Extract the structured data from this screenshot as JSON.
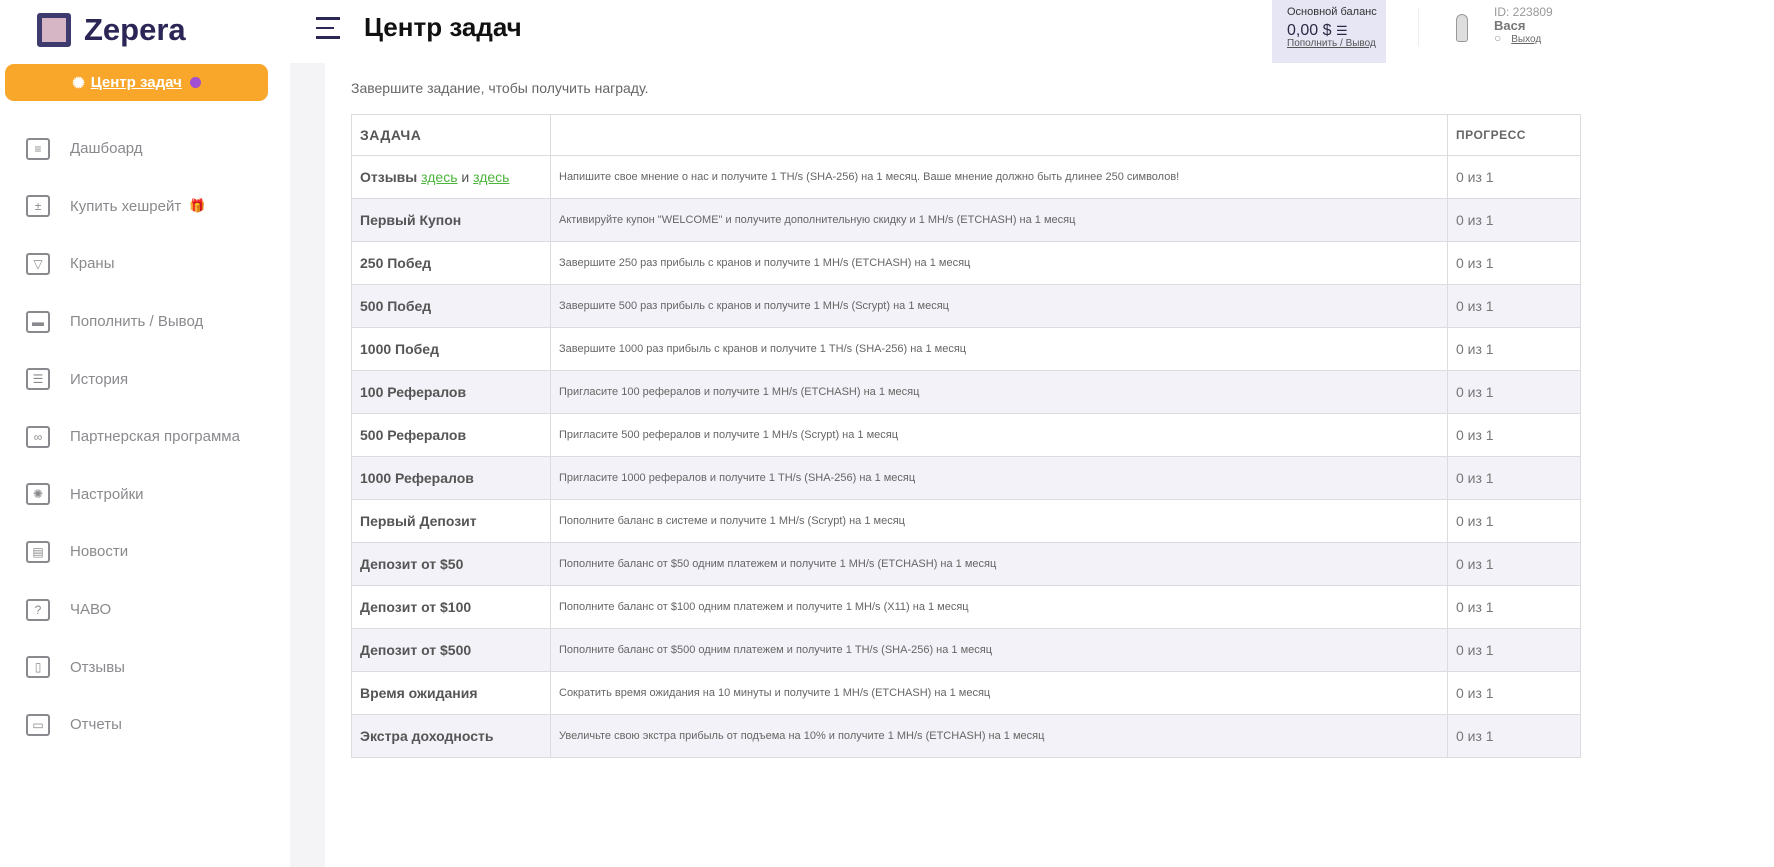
{
  "brand": "Zepera",
  "sidebar": {
    "task_center": "Центр задач",
    "items": [
      {
        "label": "Дашбоард",
        "icon": "dashboard-icon"
      },
      {
        "label": "Купить хешрейт",
        "icon": "calculator-icon"
      },
      {
        "label": "Краны",
        "icon": "funnel-icon"
      },
      {
        "label": "Пополнить / Вывод",
        "icon": "card-icon"
      },
      {
        "label": "История",
        "icon": "list-icon"
      },
      {
        "label": "Партнерская программа",
        "icon": "link-icon"
      },
      {
        "label": "Настройки",
        "icon": "gear-icon"
      },
      {
        "label": "Новости",
        "icon": "news-icon"
      },
      {
        "label": "ЧАВО",
        "icon": "question-icon"
      },
      {
        "label": "Отзывы",
        "icon": "reviews-icon"
      },
      {
        "label": "Отчеты",
        "icon": "monitor-icon"
      }
    ]
  },
  "header": {
    "title": "Центр задач",
    "balance_label": "Основной баланс",
    "balance": "0,00 $",
    "deposit_link": "Пополнить / Вывод",
    "user_id": "ID: 223809",
    "user_name": "Вася",
    "logout": "Выход"
  },
  "content": {
    "hint": "Завершите задание, чтобы получить награду.",
    "col_task": "ЗАДАЧА",
    "col_progress": "ПРОГРЕСС",
    "first_row": {
      "title": "Отзывы",
      "link1": "здесь",
      "and": "и",
      "link2": "здесь",
      "desc": "Напишите свое мнение о нас и получите 1 TH/s (SHA-256) на 1 месяц. Ваше мнение должно быть длинее 250 символов!",
      "progress": "0 из 1"
    },
    "rows": [
      {
        "title": "Первый Купон",
        "desc": "Активируйте купон \"WELCOME\" и получите дополнительную скидку и 1 MH/s (ETCHASH) на 1 месяц",
        "progress": "0 из 1"
      },
      {
        "title": "250 Побед",
        "desc": "Завершите 250 раз прибыль с кранов и получите 1 MH/s (ETCHASH) на 1 месяц",
        "progress": "0 из 1"
      },
      {
        "title": "500 Побед",
        "desc": "Завершите 500 раз прибыль с кранов и получите 1 MH/s (Scrypt) на 1 месяц",
        "progress": "0 из 1"
      },
      {
        "title": "1000 Побед",
        "desc": "Завершите 1000 раз прибыль с кранов и получите 1 TH/s (SHA-256) на 1 месяц",
        "progress": "0 из 1"
      },
      {
        "title": "100 Рефералов",
        "desc": "Пригласите 100 рефералов и получите 1 MH/s (ETCHASH) на 1 месяц",
        "progress": "0 из 1"
      },
      {
        "title": "500 Рефералов",
        "desc": "Пригласите 500 рефералов и получите 1 MH/s (Scrypt) на 1 месяц",
        "progress": "0 из 1"
      },
      {
        "title": "1000 Рефералов",
        "desc": "Пригласите 1000 рефералов и получите 1 TH/s (SHA-256) на 1 месяц",
        "progress": "0 из 1"
      },
      {
        "title": "Первый Депозит",
        "desc": "Пополните баланс в системе и получите 1 MH/s (Scrypt) на 1 месяц",
        "progress": "0 из 1"
      },
      {
        "title": "Депозит от $50",
        "desc": "Пополните баланс от $50 одним платежем и получите 1 MH/s (ETCHASH) на 1 месяц",
        "progress": "0 из 1"
      },
      {
        "title": "Депозит от $100",
        "desc": "Пополните баланс от $100 одним платежем и получите 1 MH/s (X11) на 1 месяц",
        "progress": "0 из 1"
      },
      {
        "title": "Депозит от $500",
        "desc": "Пополните баланс от $500 одним платежем и получите 1 TH/s (SHA-256) на 1 месяц",
        "progress": "0 из 1"
      },
      {
        "title": "Время ожидания",
        "desc": "Сократить время ожидания на 10 минуты и получите 1 MH/s (ETCHASH) на 1 месяц",
        "progress": "0 из 1"
      },
      {
        "title": "Экстра доходность",
        "desc": "Увеличьте свою экстра прибыль от подъема на 10% и получите 1 MH/s (ETCHASH) на 1 месяц",
        "progress": "0 из 1"
      }
    ]
  }
}
